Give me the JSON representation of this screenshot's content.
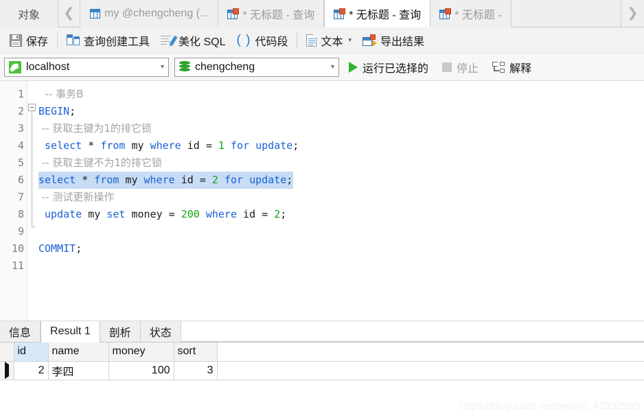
{
  "tabbar": {
    "object_tab": "对象",
    "nav_left_icon": "chevron-left-icon",
    "nav_right_icon": "chevron-right-icon",
    "tabs": [
      {
        "label": "my @chengcheng (...",
        "icon": "table-icon",
        "active": false
      },
      {
        "label": "* 无标题 - 查询",
        "icon": "query-table-icon",
        "active": false
      },
      {
        "label": "* 无标题 - 查询",
        "icon": "query-table-icon",
        "active": true
      },
      {
        "label": "* 无标题 -",
        "icon": "query-table-icon",
        "active": false
      }
    ]
  },
  "toolbar": {
    "save_label": "保存",
    "save_icon": "floppy-save-icon",
    "query_builder_label": "查询创建工具",
    "query_builder_icon": "query-builder-icon",
    "beautify_label": "美化 SQL",
    "beautify_icon": "beautify-pen-icon",
    "snippet_label": "代码段",
    "snippet_icon": "parenthesis-icon",
    "text_label": "文本",
    "text_icon": "document-icon",
    "text_caret": "▾",
    "export_label": "导出结果",
    "export_icon": "export-grid-icon"
  },
  "connbar": {
    "host": {
      "value": "localhost",
      "icon": "mysql-dolphin-icon",
      "chevron": "▾"
    },
    "database": {
      "value": "chengcheng",
      "icon": "database-cylinder-icon",
      "chevron": "▾"
    },
    "run_selected_label": "运行已选择的",
    "run_icon": "play-triangle-icon",
    "stop_label": "停止",
    "stop_icon": "stop-square-icon",
    "stop_disabled": true,
    "explain_label": "解释",
    "explain_icon": "explain-plan-icon"
  },
  "editor": {
    "line_numbers": [
      "1",
      "2",
      "3",
      "4",
      "5",
      "6",
      "7",
      "8",
      "9",
      "10",
      "11"
    ],
    "fold_marker_line": 2,
    "fold_end_line": 10,
    "selected_line": 6,
    "lines": [
      {
        "n": 1,
        "tokens": [
          {
            "t": "  -- 事务B",
            "c": "cmt"
          }
        ]
      },
      {
        "n": 2,
        "tokens": [
          {
            "t": "BEGIN",
            "c": "kw"
          },
          {
            "t": ";",
            "c": ""
          }
        ]
      },
      {
        "n": 3,
        "tokens": [
          {
            "t": " -- 获取主键为1的排它锁",
            "c": "cmt"
          }
        ]
      },
      {
        "n": 4,
        "tokens": [
          {
            "t": " ",
            "c": ""
          },
          {
            "t": "select",
            "c": "kw"
          },
          {
            "t": " * ",
            "c": ""
          },
          {
            "t": "from",
            "c": "kw"
          },
          {
            "t": " my ",
            "c": ""
          },
          {
            "t": "where",
            "c": "kw"
          },
          {
            "t": " id = ",
            "c": ""
          },
          {
            "t": "1",
            "c": "num"
          },
          {
            "t": " ",
            "c": ""
          },
          {
            "t": "for",
            "c": "kw"
          },
          {
            "t": " ",
            "c": ""
          },
          {
            "t": "update",
            "c": "kw"
          },
          {
            "t": ";",
            "c": ""
          }
        ]
      },
      {
        "n": 5,
        "tokens": [
          {
            "t": " -- 获取主键不为1的排它锁",
            "c": "cmt"
          }
        ]
      },
      {
        "n": 6,
        "selected": true,
        "tokens": [
          {
            "t": "select",
            "c": "kw"
          },
          {
            "t": " * ",
            "c": ""
          },
          {
            "t": "from",
            "c": "kw"
          },
          {
            "t": " my ",
            "c": ""
          },
          {
            "t": "where",
            "c": "kw"
          },
          {
            "t": " id = ",
            "c": ""
          },
          {
            "t": "2",
            "c": "num"
          },
          {
            "t": " ",
            "c": ""
          },
          {
            "t": "for",
            "c": "kw"
          },
          {
            "t": " ",
            "c": ""
          },
          {
            "t": "update",
            "c": "kw"
          },
          {
            "t": ";",
            "c": ""
          }
        ]
      },
      {
        "n": 7,
        "tokens": [
          {
            "t": " -- 测试更新操作",
            "c": "cmt"
          }
        ]
      },
      {
        "n": 8,
        "tokens": [
          {
            "t": " ",
            "c": ""
          },
          {
            "t": "update",
            "c": "kw"
          },
          {
            "t": " my ",
            "c": ""
          },
          {
            "t": "set",
            "c": "kw"
          },
          {
            "t": " money = ",
            "c": ""
          },
          {
            "t": "200",
            "c": "num"
          },
          {
            "t": " ",
            "c": ""
          },
          {
            "t": "where",
            "c": "kw"
          },
          {
            "t": " id = ",
            "c": ""
          },
          {
            "t": "2",
            "c": "num"
          },
          {
            "t": ";",
            "c": ""
          }
        ]
      },
      {
        "n": 9,
        "tokens": [
          {
            "t": "",
            "c": ""
          }
        ]
      },
      {
        "n": 10,
        "tokens": [
          {
            "t": "COMMIT",
            "c": "kw"
          },
          {
            "t": ";",
            "c": ""
          }
        ]
      },
      {
        "n": 11,
        "tokens": [
          {
            "t": "",
            "c": ""
          }
        ]
      }
    ]
  },
  "result": {
    "tabs": [
      {
        "label": "信息",
        "active": false
      },
      {
        "label": "Result 1",
        "active": true
      },
      {
        "label": "剖析",
        "active": false
      },
      {
        "label": "状态",
        "active": false
      }
    ],
    "columns": [
      "id",
      "name",
      "money",
      "sort"
    ],
    "highlighted_column": "id",
    "rows": [
      {
        "id": "2",
        "name": "李四",
        "money": "100",
        "sort": "3",
        "current": true
      }
    ]
  },
  "watermark": "https://blog.csdn.net/weixin_42332985"
}
